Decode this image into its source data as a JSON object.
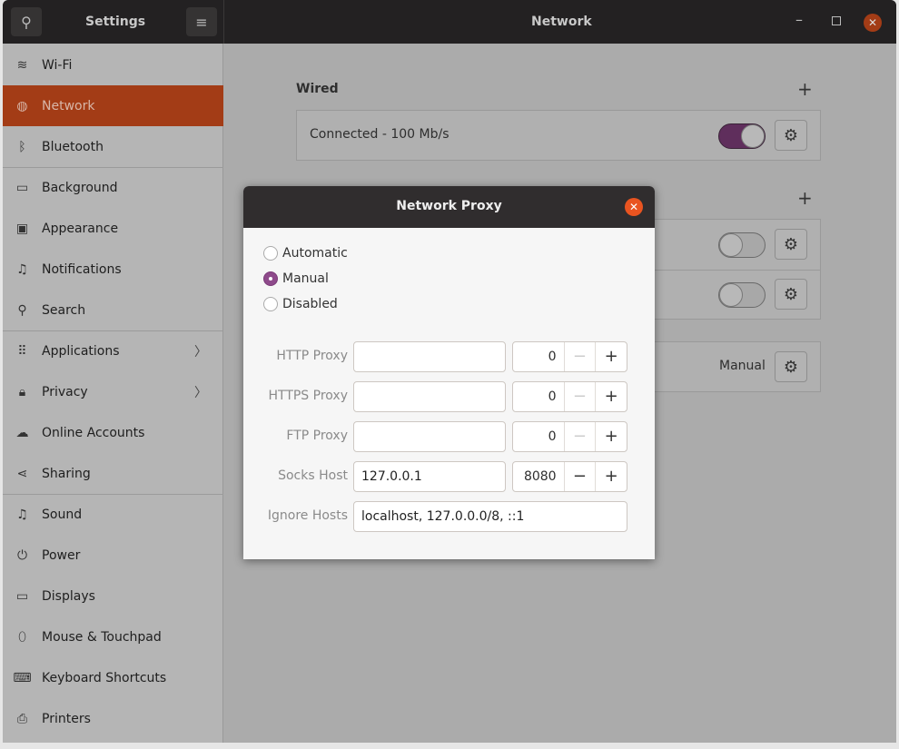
{
  "header": {
    "settings_title": "Settings",
    "page_title": "Network",
    "search_icon": "search-icon",
    "menu_icon": "hamburger-icon"
  },
  "sidebar": {
    "items": [
      {
        "label": "Wi-Fi",
        "icon": "wifi-icon",
        "glyph": "≋"
      },
      {
        "label": "Network",
        "icon": "globe-icon",
        "glyph": "◍",
        "selected": true
      },
      {
        "label": "Bluetooth",
        "icon": "bluetooth-icon",
        "glyph": "ᛒ"
      },
      {
        "label": "Background",
        "icon": "monitor-icon",
        "glyph": "▭"
      },
      {
        "label": "Appearance",
        "icon": "appearance-icon",
        "glyph": "▣"
      },
      {
        "label": "Notifications",
        "icon": "bell-icon",
        "glyph": "♫"
      },
      {
        "label": "Search",
        "icon": "search-icon",
        "glyph": "⚲"
      },
      {
        "label": "Applications",
        "icon": "grid-icon",
        "glyph": "⠿",
        "chevron": true
      },
      {
        "label": "Privacy",
        "icon": "lock-icon",
        "glyph": "🔒︎",
        "chevron": true
      },
      {
        "label": "Online Accounts",
        "icon": "cloud-icon",
        "glyph": "☁"
      },
      {
        "label": "Sharing",
        "icon": "share-icon",
        "glyph": "⋖"
      },
      {
        "label": "Sound",
        "icon": "music-icon",
        "glyph": "♫"
      },
      {
        "label": "Power",
        "icon": "power-icon",
        "glyph": "⏻"
      },
      {
        "label": "Displays",
        "icon": "display-icon",
        "glyph": "▭"
      },
      {
        "label": "Mouse & Touchpad",
        "icon": "mouse-icon",
        "glyph": "⬯"
      },
      {
        "label": "Keyboard Shortcuts",
        "icon": "keyboard-icon",
        "glyph": "⌨"
      },
      {
        "label": "Printers",
        "icon": "printer-icon",
        "glyph": "⎙"
      }
    ]
  },
  "main": {
    "wired_heading": "Wired",
    "wired_status": "Connected - 100 Mb/s",
    "wired_on": true,
    "proxy_mode": "Manual"
  },
  "dialog": {
    "title": "Network Proxy",
    "modes": [
      "Automatic",
      "Manual",
      "Disabled"
    ],
    "selected_mode": "Manual",
    "fields": [
      {
        "label": "HTTP Proxy",
        "host": "",
        "port": "0"
      },
      {
        "label": "HTTPS Proxy",
        "host": "",
        "port": "0"
      },
      {
        "label": "FTP Proxy",
        "host": "",
        "port": "0"
      },
      {
        "label": "Socks Host",
        "host": "127.0.0.1",
        "port": "8080"
      }
    ],
    "ignore_label": "Ignore Hosts",
    "ignore_value": "localhost, 127.0.0.0/8, ::1"
  },
  "colors": {
    "accent": "#a33c16",
    "toggle_on": "#5f2e5c",
    "radio": "#8e4a8b",
    "close": "#e95420"
  }
}
